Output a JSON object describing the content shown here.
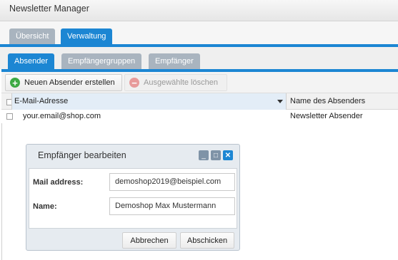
{
  "app": {
    "title": "Newsletter Manager"
  },
  "main_tabs": [
    {
      "label": "Übersicht",
      "active": false
    },
    {
      "label": "Verwaltung",
      "active": true
    }
  ],
  "sub_tabs": [
    {
      "label": "Absender",
      "active": true
    },
    {
      "label": "Empfängergruppen",
      "active": false
    },
    {
      "label": "Empfänger",
      "active": false
    }
  ],
  "toolbar": {
    "create_label": "Neuen Absender erstellen",
    "delete_label": "Ausgewählte löschen"
  },
  "grid": {
    "columns": [
      "E-Mail-Adresse",
      "Name des Absenders"
    ],
    "rows": [
      [
        "your.email@shop.com",
        "Newsletter Absender"
      ]
    ]
  },
  "dialog": {
    "title": "Empfänger bearbeiten",
    "fields": [
      {
        "label": "Mail address:",
        "value": "demoshop2019@beispiel.com"
      },
      {
        "label": "Name:",
        "value": "Demoshop Max Mustermann"
      }
    ],
    "cancel_label": "Abbrechen",
    "submit_label": "Abschicken"
  },
  "colors": {
    "accent": "#1c86d3",
    "tab_inactive": "#a9b4bf",
    "add_icon": "#3da944",
    "delete_icon": "#e79a9a"
  },
  "icons": {
    "add": "plus-circle-icon",
    "delete": "minus-circle-icon",
    "sort": "chevron-down-icon",
    "minimize": "minimize-icon",
    "maximize": "maximize-icon",
    "close": "close-icon"
  }
}
